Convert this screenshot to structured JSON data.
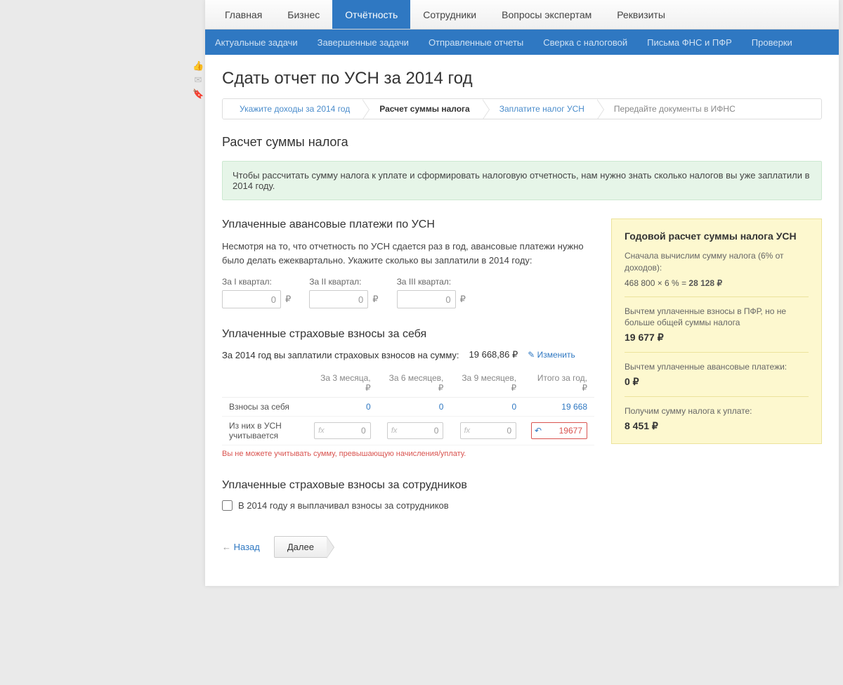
{
  "topnav": {
    "items": [
      "Главная",
      "Бизнес",
      "Отчётность",
      "Сотрудники",
      "Вопросы экспертам",
      "Реквизиты"
    ],
    "active_index": 2
  },
  "subnav": {
    "items": [
      "Актуальные задачи",
      "Завершенные задачи",
      "Отправленные отчеты",
      "Сверка с налоговой",
      "Письма ФНС и ПФР",
      "Проверки"
    ]
  },
  "page_title": "Сдать отчет по УСН за 2014 год",
  "wizard": {
    "steps": [
      "Укажите доходы за 2014 год",
      "Расчет суммы налога",
      "Заплатите налог УСН",
      "Передайте документы в ИФНС"
    ],
    "active_index": 1
  },
  "section_title": "Расчет суммы налога",
  "info_banner": "Чтобы рассчитать сумму налога к уплате и сформировать налоговую отчетность, нам нужно знать сколько налогов вы уже заплатили в 2014 году.",
  "advance": {
    "heading": "Уплаченные авансовые платежи по УСН",
    "text": "Несмотря на то, что отчетность по УСН сдается раз в год, авансовые платежи нужно было делать ежеквартально. Укажите сколько вы заплатили в 2014 году:",
    "q1_label": "За I квартал:",
    "q2_label": "За II квартал:",
    "q3_label": "За III квартал:",
    "q1_value": "0",
    "q2_value": "0",
    "q3_value": "0",
    "currency": "₽"
  },
  "insurance_self": {
    "heading": "Уплаченные страховые взносы за себя",
    "paid_label": "За 2014 год вы заплатили страховых взносов на сумму:",
    "paid_amount": "19 668,86 ₽",
    "edit_label": "Изменить",
    "cols": [
      "",
      "За 3 месяца, ₽",
      "За 6 месяцев, ₽",
      "За 9 месяцев, ₽",
      "Итого за год, ₽"
    ],
    "row1_label": "Взносы за себя",
    "row1_vals": [
      "0",
      "0",
      "0",
      "19 668"
    ],
    "row2_label": "Из них в УСН учитывается",
    "row2_vals": [
      "0",
      "0",
      "0",
      "19677"
    ],
    "error_text": "Вы не можете учитывать сумму, превышающую начисления/уплату."
  },
  "insurance_emp": {
    "heading": "Уплаченные страховые взносы за сотрудников",
    "checkbox_label": "В 2014 году я выплачивал взносы за сотрудников"
  },
  "sidecard": {
    "title": "Годовой расчет суммы налога УСН",
    "line1": "Сначала вычислим сумму налога (6% от доходов):",
    "formula_left": "468 800 × 6 % = ",
    "formula_right": "28 128 ₽",
    "line2": "Вычтем уплаченные взносы в ПФР, но не больше общей суммы налога",
    "val2": "19 677 ₽",
    "line3": "Вычтем уплаченные авансовые платежи:",
    "val3": "0 ₽",
    "line4": "Получим сумму налога к уплате:",
    "val4": "8 451 ₽"
  },
  "footer": {
    "back": "Назад",
    "next": "Далее"
  },
  "fx_placeholder": "fx"
}
